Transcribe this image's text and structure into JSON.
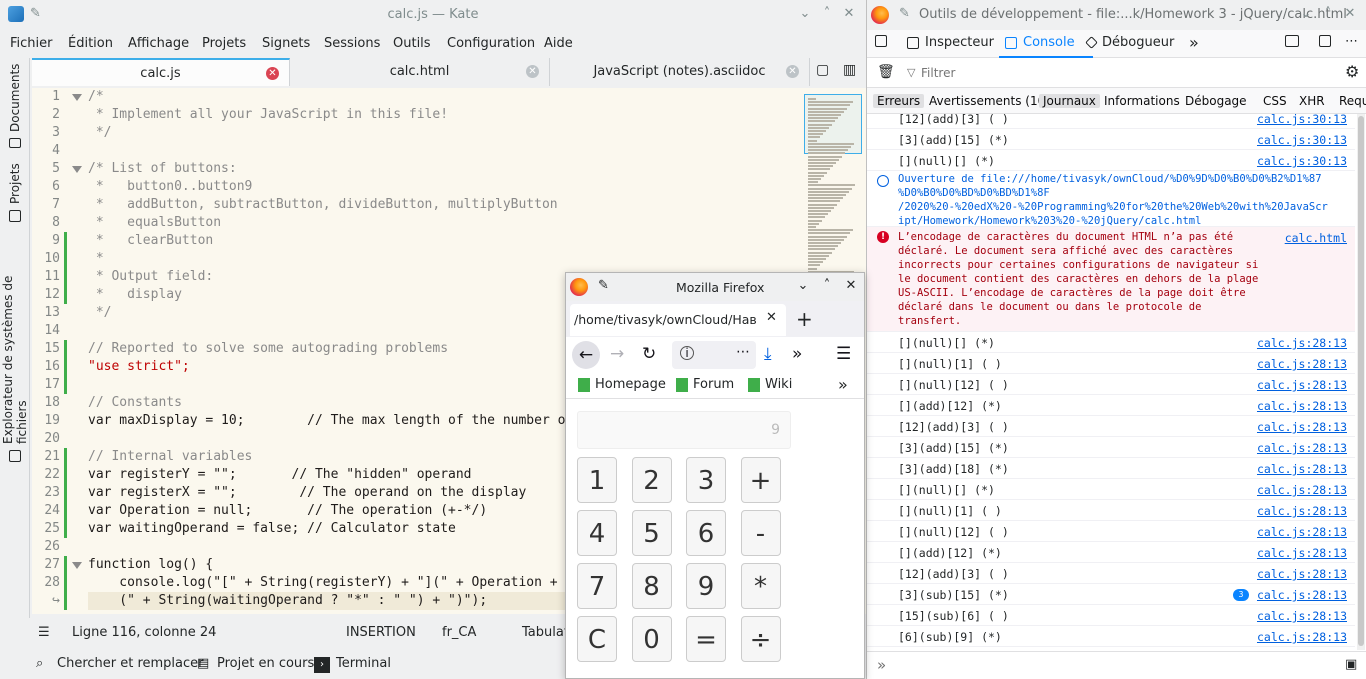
{
  "kate": {
    "title": "calc.js — Kate",
    "menu": [
      "Fichier",
      "Édition",
      "Affichage",
      "Projets",
      "Signets",
      "Sessions",
      "Outils",
      "Configuration",
      "Aide"
    ],
    "side_tabs": [
      "Documents",
      "Projets",
      "Explorateur de systèmes de fichiers"
    ],
    "tabs": [
      {
        "label": "calc.js",
        "active": true
      },
      {
        "label": "calc.html",
        "active": false
      },
      {
        "label": "JavaScript (notes).asciidoc",
        "active": false
      }
    ],
    "code_lines": [
      "/*",
      " * Implement all your JavaScript in this file!",
      " */",
      "",
      "/* List of buttons:",
      " *   button0..button9",
      " *   addButton, subtractButton, divideButton, multiplyButton",
      " *   equalsButton",
      " *   clearButton",
      " *",
      " * Output field:",
      " *   display",
      " */",
      "",
      "// Reported to solve some autograding problems",
      "\"use strict\";",
      "",
      "// Constants",
      "var maxDisplay = 10;        // The max length of the number o",
      "",
      "// Internal variables",
      "var registerY = \"\";       // The \"hidden\" operand",
      "var registerX = \"\";        // The operand on the display",
      "var Operation = null;       // The operation (+-*/)",
      "var waitingOperand = false; // Calculator state",
      "",
      "function log() {",
      "    console.log(\"[\" + String(registerY) + \"](\" + Operation +",
      "    (\" + String(waitingOperand ? \"*\" : \" \") + \")\");"
    ],
    "line_numbers": [
      "1",
      "2",
      "3",
      "4",
      "5",
      "6",
      "7",
      "8",
      "9",
      "10",
      "11",
      "12",
      "13",
      "14",
      "15",
      "16",
      "17",
      "18",
      "19",
      "20",
      "21",
      "22",
      "23",
      "24",
      "25",
      "26",
      "27",
      "28",
      "↪"
    ],
    "status": {
      "position": "Ligne 116, colonne 24",
      "mode": "INSERTION",
      "lang": "fr_CA",
      "tab": "Tabulat"
    },
    "bottom": [
      "Chercher et remplacer",
      "Projet en cours",
      "Terminal"
    ]
  },
  "devtools": {
    "title": "Outils de développement - file:...k/Homework 3 - jQuery/calc.html",
    "toolbar": [
      "Inspecteur",
      "Console",
      "Débogueur"
    ],
    "filter_placeholder": "Filtrer",
    "categories": [
      "Erreurs",
      "Avertissements (10)",
      "Journaux",
      "Informations",
      "Débogage",
      "CSS",
      "XHR",
      "Requêt"
    ],
    "logs_top": [
      {
        "msg": "[12](add)[3] ( )",
        "src": "calc.js:30:13"
      },
      {
        "msg": "[3](add)[15] (*)",
        "src": "calc.js:30:13"
      },
      {
        "msg": "[](null)[] (*)",
        "src": "calc.js:30:13"
      }
    ],
    "info_msg": [
      "Ouverture de file:///home/tivasyk/ownCloud/%D0%9D%D0%B0%D0%B2%D1%87",
      "%D0%B0%D0%BD%D0%BD%D1%8F",
      "/2020%20-%20edX%20-%20Programming%20for%20the%20Web%20with%20JavaScr",
      "ipt/Homework/Homework%203%20-%20jQuery/calc.html"
    ],
    "error_msg": [
      "L’encodage de caractères du document HTML n’a pas été",
      "déclaré. Le document sera affiché avec des caractères",
      "incorrects pour certaines configurations de navigateur si",
      "le document contient des caractères en dehors de la plage",
      "US-ASCII. L’encodage de caractères de la page doit être",
      "déclaré dans le document ou dans le protocole de",
      "transfert."
    ],
    "error_src": "calc.html",
    "logs": [
      {
        "msg": "[](null)[] (*)",
        "src": "calc.js:28:13"
      },
      {
        "msg": "[](null)[1] ( )",
        "src": "calc.js:28:13"
      },
      {
        "msg": "[](null)[12] ( )",
        "src": "calc.js:28:13"
      },
      {
        "msg": "[](add)[12] (*)",
        "src": "calc.js:28:13"
      },
      {
        "msg": "[12](add)[3] ( )",
        "src": "calc.js:28:13"
      },
      {
        "msg": "[3](add)[15] (*)",
        "src": "calc.js:28:13"
      },
      {
        "msg": "[3](add)[18] (*)",
        "src": "calc.js:28:13"
      },
      {
        "msg": "[](null)[] (*)",
        "src": "calc.js:28:13"
      },
      {
        "msg": "[](null)[1] ( )",
        "src": "calc.js:28:13"
      },
      {
        "msg": "[](null)[12] ( )",
        "src": "calc.js:28:13"
      },
      {
        "msg": "[](add)[12] (*)",
        "src": "calc.js:28:13"
      },
      {
        "msg": "[12](add)[3] ( )",
        "src": "calc.js:28:13"
      },
      {
        "msg": "[3](sub)[15] (*)",
        "src": "calc.js:28:13",
        "badge": "3"
      },
      {
        "msg": "[15](sub)[6] ( )",
        "src": "calc.js:28:13"
      },
      {
        "msg": "[6](sub)[9] (*)",
        "src": "calc.js:28:13"
      }
    ],
    "prompt": "»"
  },
  "firefox": {
    "title": "Mozilla Firefox",
    "tab_label": "/home/tivasyk/ownCloud/Нав",
    "bookmarks": [
      "Homepage",
      "Forum",
      "Wiki"
    ],
    "display_value": "9",
    "keys": [
      "1",
      "2",
      "3",
      "+",
      "4",
      "5",
      "6",
      "-",
      "7",
      "8",
      "9",
      "*",
      "C",
      "0",
      "=",
      "÷"
    ]
  }
}
